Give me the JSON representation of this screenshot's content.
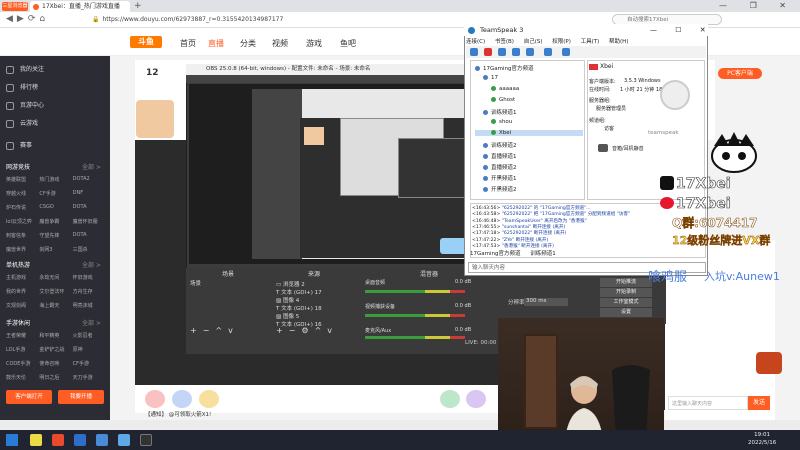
{
  "browser": {
    "badge": "三星浏览器",
    "tab_title": "17Xbei",
    "tab_title_full": "17Xbei：直播_热门游戏直播",
    "new_tab": "+",
    "window_controls": "— ❐ ✕",
    "url": "https://www.douyu.com/62973887_r=0.3155420134987177",
    "search_placeholder": "自动搜索17Xbei"
  },
  "douyu_nav": {
    "logo": "斗鱼",
    "items": [
      "首页",
      "直播",
      "分类",
      "视频",
      "游戏",
      "鱼吧"
    ],
    "pc_button": "PC客户端"
  },
  "sidebar": {
    "items": [
      {
        "label": "我的关注",
        "icon": "heart-icon"
      },
      {
        "label": "排行榜",
        "icon": "rank-icon"
      },
      {
        "label": "页游中心",
        "icon": "gamepad-icon"
      },
      {
        "label": "云游戏",
        "icon": "cloud-icon"
      },
      {
        "label": "赛事",
        "icon": "trophy-icon"
      }
    ],
    "sections": [
      {
        "title": "网游竞技",
        "more": "全部 >",
        "games": [
          "英雄联盟",
          "热门游戏",
          "DOTA2",
          "穿越火线",
          "CF手游",
          "DNF",
          "炉石传说",
          "CSGO",
          "DOTA",
          "lol云顶之弈",
          "魔兽争霸",
          "魔兽怀旧服",
          "刺客信条",
          "守望先锋",
          "DOTA",
          "魔兽世界",
          "剑网3",
          "三国杀"
        ]
      },
      {
        "title": "单机热游",
        "more": "全部 >",
        "games": [
          "主机游戏",
          "永劫无间",
          "怀旧游戏",
          "我的世界",
          "艾尔登法环",
          "方舟生存",
          "文观剑阁",
          "海上霸天",
          "明亮沫城"
        ]
      },
      {
        "title": "手游休闲",
        "more": "全部 >",
        "games": [
          "王者荣耀",
          "和平精英",
          "火影忍者",
          "LOL手游",
          "金铲铲之战",
          "原神",
          "CODE手游",
          "使命召唤",
          "CF手游",
          "鼓乐天伦",
          "明日之后",
          "天刀手游"
        ]
      }
    ],
    "btn_left": "客户端打开",
    "btn_right": "我要开播"
  },
  "room": {
    "number": "12",
    "notice": "【通知】 @可领取火箭X1!"
  },
  "obs": {
    "title": "OBS 25.0.8 (64-bit, windows) - 配置文件: 未命名 - 场景: 未命名",
    "dock_titles": [
      "场景",
      "来源",
      "混音器"
    ],
    "scene": "场景",
    "sources": [
      {
        "name": "浏览器 2"
      },
      {
        "name": "文本 (GDI+) 17"
      },
      {
        "name": "图像 4"
      },
      {
        "name": "文本 (GDI+) 18"
      },
      {
        "name": "图像 5"
      },
      {
        "name": "文本 (GDI+) 16"
      }
    ],
    "mixer": [
      {
        "label": "桌面音频",
        "db": "0.0 dB"
      },
      {
        "label": "视频捕获设备",
        "db": "0.0 dB"
      },
      {
        "label": "麦克风/Aux",
        "db": "0.0 dB"
      }
    ],
    "controls": [
      "开始录制",
      "工作室模式",
      "设置",
      "退出"
    ],
    "stream_btn": "开始推流",
    "status": "LIVE: 00:00",
    "fps_label": "分辨率",
    "fps_value": "300 ms"
  },
  "teamspeak": {
    "title": "TeamSpeak 3",
    "window_controls": "— ☐ ✕",
    "menu": [
      "连接(C)",
      "书签(B)",
      "自己(S)",
      "权限(P)",
      "工具(T)",
      "帮助(H)"
    ],
    "tree": [
      {
        "label": "17Gaming官方频道",
        "indent": 0,
        "state": "server"
      },
      {
        "label": "17",
        "indent": 1,
        "state": "channel"
      },
      {
        "label": "aaaaaa",
        "indent": 2,
        "state": "user"
      },
      {
        "label": "Ghost",
        "indent": 2,
        "state": "user"
      },
      {
        "label": "训练频道1",
        "indent": 1,
        "state": "channel"
      },
      {
        "label": "shou",
        "indent": 2,
        "state": "user"
      },
      {
        "label": "Xbei",
        "indent": 2,
        "state": "user-selected"
      },
      {
        "label": "训练频道2",
        "indent": 1,
        "state": "channel"
      },
      {
        "label": "直播频道1",
        "indent": 1,
        "state": "channel"
      },
      {
        "label": "直播频道2",
        "indent": 1,
        "state": "channel"
      },
      {
        "label": "开黑频道1",
        "indent": 1,
        "state": "channel"
      },
      {
        "label": "开黑频道2",
        "indent": 1,
        "state": "channel"
      }
    ],
    "info": {
      "username": "Xbei",
      "rows": [
        {
          "k": "客户端版本:",
          "v": "3.5.3 Windows"
        },
        {
          "k": "在线时间:",
          "v": "1 小时 21 分钟 18 秒"
        },
        {
          "k": "服务器组:",
          "v": ""
        },
        {
          "k": "",
          "v": "服务器管理员"
        },
        {
          "k": "频道组:",
          "v": ""
        },
        {
          "k": "",
          "v": "访客"
        }
      ],
      "logo_text": "teamspeak",
      "mic_label": "音箱/耳机静音"
    },
    "log": [
      {
        "time": "<16:43:56>",
        "text": "\"625292022\" 的 \"17Gaming官方频道\"..."
      },
      {
        "time": "<16:43:58>",
        "text": "\"625292022\" 把 \"17Gaming官方频道\" 分配到频道组 \"访客\""
      },
      {
        "time": "<16:46:48>",
        "text": "\"TeamSpeakUser\" 离开后改为 \"香港猴\""
      },
      {
        "time": "<17:46:55>",
        "text": "\"sunshantai\" 断开连接 (离开)"
      },
      {
        "time": "<17:47:18>",
        "text": "\"625292022\" 断开连接 (离开)"
      },
      {
        "time": "<17:47:22>",
        "text": "\"ZYe\" 断开连接 (离开)"
      },
      {
        "time": "<17:47:53>",
        "text": "\"香港猴\" 断开连接 (离开)"
      }
    ],
    "tabs": [
      "17Gaming官方频道",
      "训练频道1"
    ],
    "input_placeholder": "输入聊天内容"
  },
  "overlay": {
    "tiktok": "17Xbei",
    "weibo": "17Xbei",
    "qq": "Q群:6074417",
    "fans": "12级粉丝牌进VX群",
    "ad_prefix": "喰鸡服",
    "ad_text": "入坑v:Aunew1"
  },
  "chat": {
    "placeholder": "这里输入聊天内容",
    "send": "发送"
  },
  "taskbar": {
    "time": "19:01",
    "date": "2022/5/16"
  },
  "colors": {
    "accent": "#ff5d23",
    "sidebar_bg": "#2c2c34",
    "ts_blue": "#2579bd"
  }
}
